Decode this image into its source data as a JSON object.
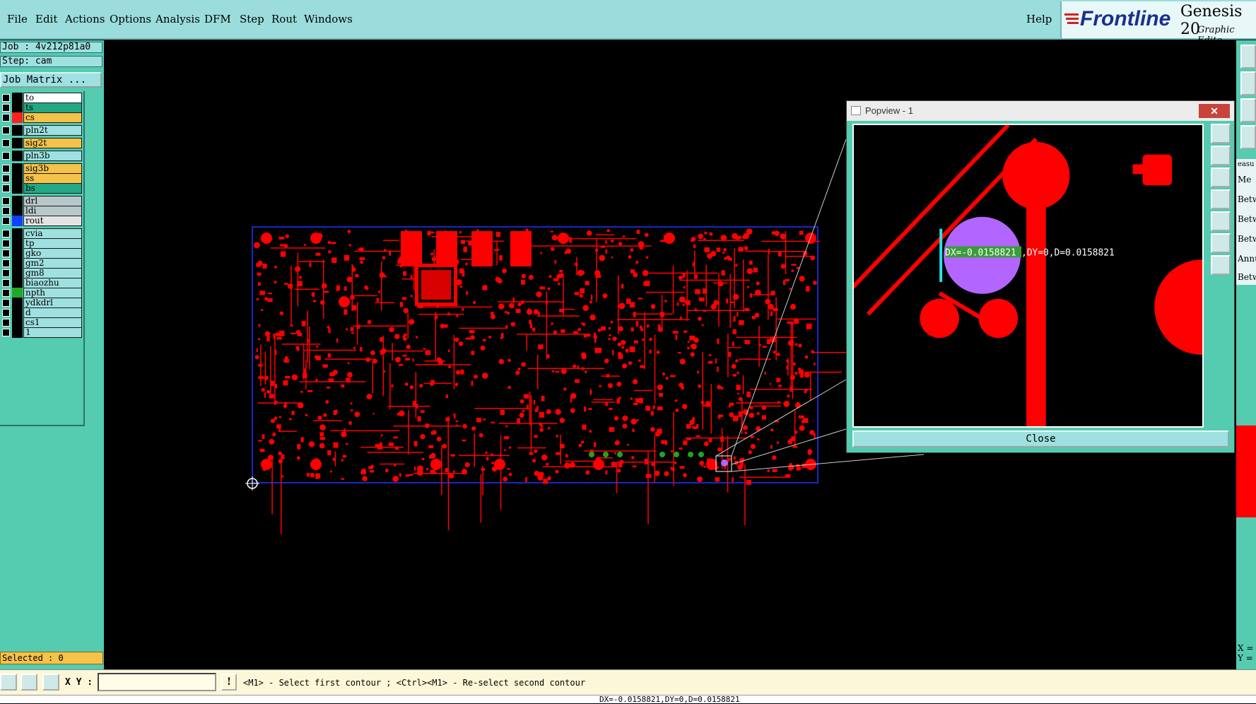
{
  "menu": {
    "items": [
      "File",
      "Edit",
      "Actions",
      "Options",
      "Analysis",
      "DFM",
      "Step",
      "Rout",
      "Windows"
    ],
    "help": "Help"
  },
  "brand": {
    "logo": "Frontline",
    "product": "Genesis 20",
    "subtitle": "Graphic Edito"
  },
  "job": {
    "job_label": "Job : 4v212p81a0",
    "step_label": "Step: cam",
    "matrix_button": "Job Matrix ..."
  },
  "layers": [
    {
      "name": "to",
      "color": "#ffffff",
      "indicator": "#000000"
    },
    {
      "name": "ts",
      "color": "#22a884",
      "indicator": "#000000"
    },
    {
      "name": "cs",
      "color": "#f5c24a",
      "indicator": "#ff2020"
    },
    {
      "name": "pln2t",
      "color": "#9fe0e0",
      "indicator": "#000000"
    },
    {
      "name": "sig2t",
      "color": "#f5c24a",
      "indicator": "#000000"
    },
    {
      "name": "pln3b",
      "color": "#9fe0e0",
      "indicator": "#000000"
    },
    {
      "name": "sig3b",
      "color": "#f5c24a",
      "indicator": "#000000"
    },
    {
      "name": "ss",
      "color": "#f5c24a",
      "indicator": "#000000"
    },
    {
      "name": "bs",
      "color": "#22a884",
      "indicator": "#000000"
    },
    {
      "name": "drl",
      "color": "#b8c8c8",
      "indicator": "#000000"
    },
    {
      "name": "ldi",
      "color": "#b8c8c8",
      "indicator": "#000000"
    },
    {
      "name": "rout",
      "color": "#e4e4e4",
      "indicator": "#1040ff"
    },
    {
      "name": "cvia",
      "color": "#9fe0e0",
      "indicator": "#000000"
    },
    {
      "name": "tp",
      "color": "#9fe0e0",
      "indicator": "#000000"
    },
    {
      "name": "gko",
      "color": "#9fe0e0",
      "indicator": "#000000"
    },
    {
      "name": "gm2",
      "color": "#9fe0e0",
      "indicator": "#000000"
    },
    {
      "name": "gm8",
      "color": "#9fe0e0",
      "indicator": "#000000"
    },
    {
      "name": "biaozhu",
      "color": "#9fe0e0",
      "indicator": "#000000"
    },
    {
      "name": "npth",
      "color": "#9fe0e0",
      "indicator": "#22a822"
    },
    {
      "name": "ydkdrl",
      "color": "#9fe0e0",
      "indicator": "#000000"
    },
    {
      "name": "d",
      "color": "#9fe0e0",
      "indicator": "#000000"
    },
    {
      "name": "cs1",
      "color": "#9fe0e0",
      "indicator": "#000000"
    },
    {
      "name": "1",
      "color": "#9fe0e0",
      "indicator": "#000000"
    }
  ],
  "selected": "Selected : 0",
  "bottombar": {
    "xy_label": "X Y :",
    "xy_value": "",
    "excl": "!",
    "hint": "<M1> - Select first contour ; <Ctrl><M1> - Re-select second contour"
  },
  "status": "DX=-0.0158821,DY=0,D=0.0158821",
  "popview": {
    "title": "Popview - 1",
    "close_x": "✕",
    "measure_dx_part": "DX=-0.0158821",
    "measure_rest": ",DY=0,D=0.0158821",
    "close_button": "Close"
  },
  "right_panel": {
    "labels": [
      "easu",
      "Me",
      "Betw",
      "Betw",
      "Betw",
      "Annu",
      "Betw"
    ],
    "coord_x": "X =",
    "coord_y": "Y ="
  },
  "colors": {
    "copper": "#ff0000",
    "profile": "#1428c8",
    "highlight": "#b266ff",
    "panel": "#55cbb0"
  }
}
